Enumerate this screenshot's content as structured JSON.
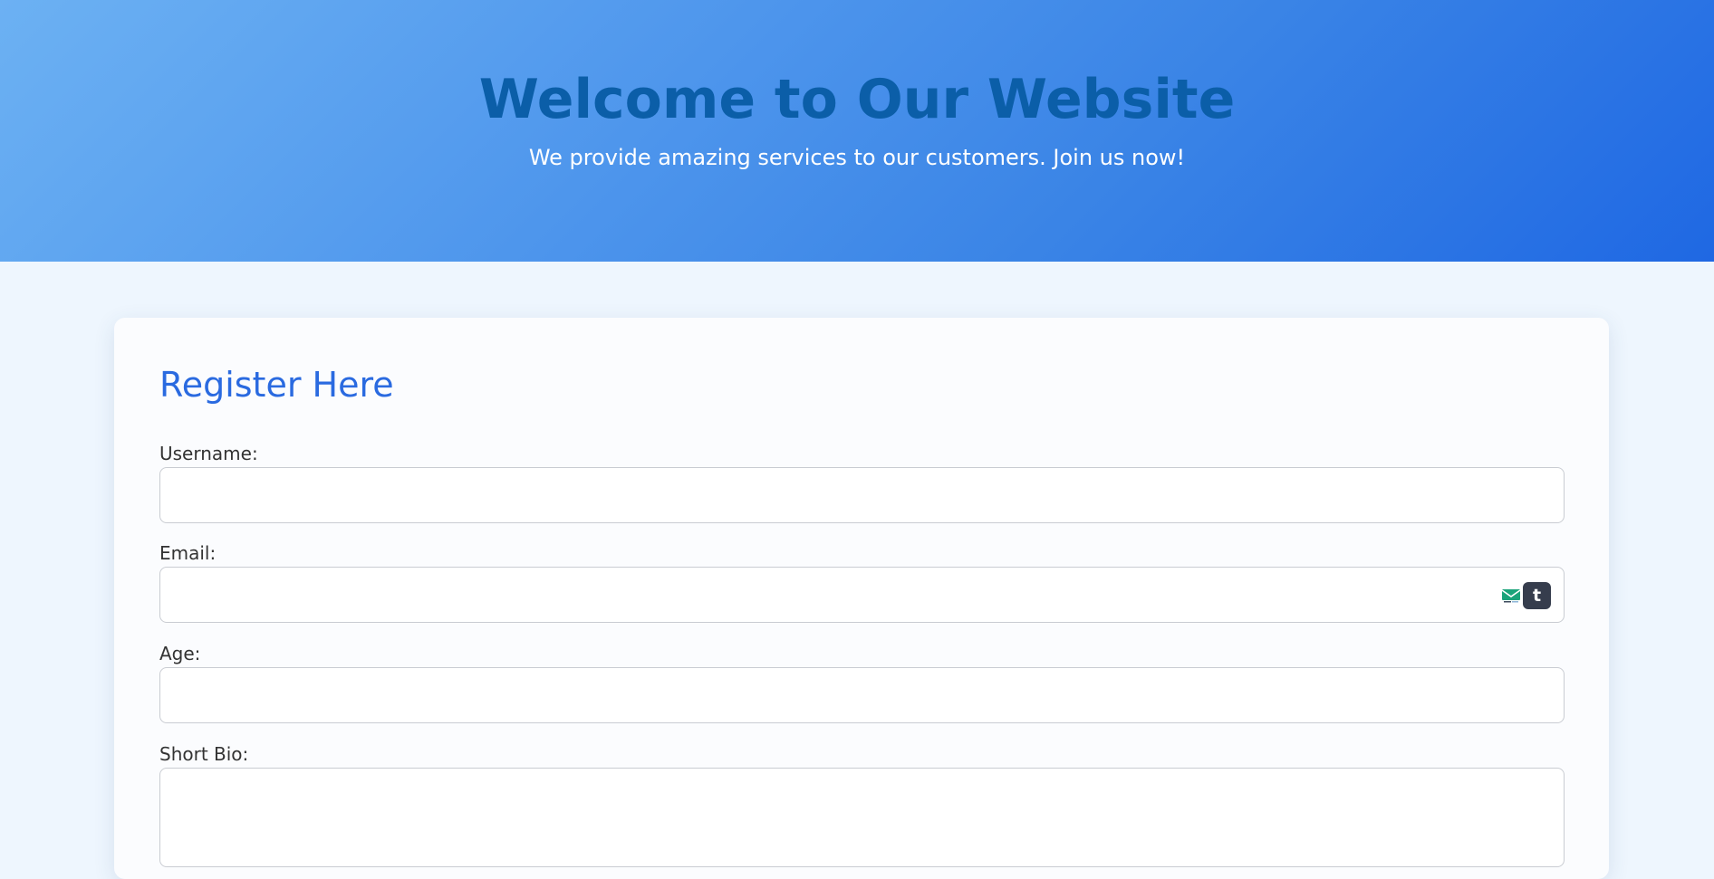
{
  "hero": {
    "title": "Welcome to Our Website",
    "subtitle": "We provide amazing services to our customers. Join us now!"
  },
  "form": {
    "title": "Register Here",
    "fields": [
      {
        "label": "Username:",
        "value": ""
      },
      {
        "label": "Email:",
        "value": ""
      },
      {
        "label": "Age:",
        "value": ""
      },
      {
        "label": "Short Bio:",
        "value": ""
      }
    ],
    "extension_icons": {
      "mail_icon": "mail-icon",
      "t_label": "t"
    }
  },
  "colors": {
    "hero_gradient_start": "#6cb1f3",
    "hero_gradient_end": "#1f68e3",
    "hero_title": "#0b5ea8",
    "form_title": "#2a6ae0",
    "page_background": "#eef6fe"
  }
}
